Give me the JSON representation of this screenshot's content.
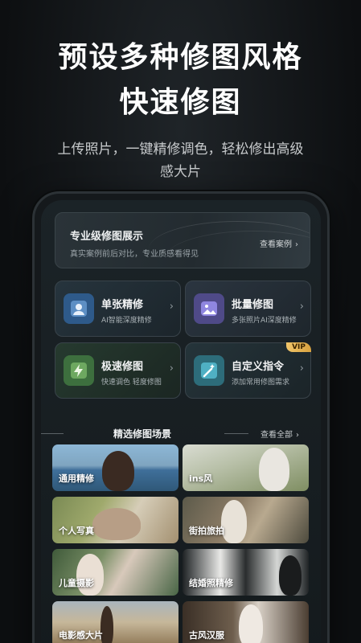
{
  "promo": {
    "headline_line1": "预设多种修图风格",
    "headline_line2": "快速修图",
    "subline_line1": "上传照片，一键精修调色，轻松修出高级",
    "subline_line2": "感大片"
  },
  "showcase": {
    "title": "专业级修图展示",
    "subtitle": "真实案例前后对比，专业质感看得见",
    "link": "查看案例",
    "chevron": "›"
  },
  "features": [
    {
      "title": "单张精修",
      "desc": "AI智能深度精修",
      "icon": "portrait-icon"
    },
    {
      "title": "批量修图",
      "desc": "多张照片AI深度精修",
      "icon": "gallery-icon"
    },
    {
      "title": "极速修图",
      "desc": "快速调色   轻度修图",
      "icon": "lightning-icon"
    },
    {
      "title": "自定义指令",
      "desc": "添加常用修图需求",
      "icon": "magic-wand-icon",
      "badge": "VIP"
    }
  ],
  "section": {
    "title": "精选修图场景",
    "view_all": "查看全部",
    "chevron": "›"
  },
  "scenes": [
    {
      "label": "通用精修"
    },
    {
      "label": "ins风"
    },
    {
      "label": "个人写真"
    },
    {
      "label": "街拍旅拍"
    },
    {
      "label": "儿童摄影"
    },
    {
      "label": "结婚照精修"
    },
    {
      "label": "电影感大片"
    },
    {
      "label": "古风汉服"
    }
  ],
  "colors": {
    "background": "#0d0f11",
    "vip_gold": "#f1c56a",
    "accent_blue": "#2e5a8a",
    "accent_purple": "#4f4a88",
    "accent_green": "#3d6f3e",
    "accent_teal": "#2d6c7a"
  }
}
